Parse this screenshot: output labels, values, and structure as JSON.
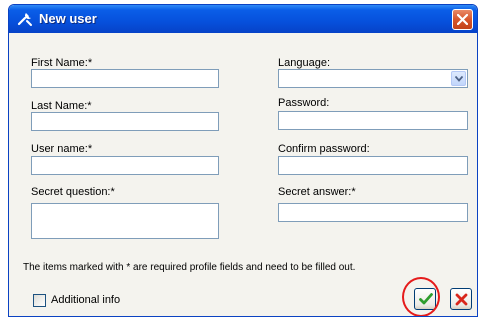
{
  "window": {
    "title": "New user"
  },
  "form": {
    "first_name_label": "First Name:*",
    "first_name_value": "",
    "last_name_label": "Last Name:*",
    "last_name_value": "",
    "user_name_label": "User name:*",
    "user_name_value": "",
    "secret_question_label": "Secret question:*",
    "secret_question_value": "",
    "language_label": "Language:",
    "language_value": "",
    "password_label": "Password:",
    "password_value": "",
    "confirm_password_label": "Confirm password:",
    "confirm_password_value": "",
    "secret_answer_label": "Secret answer:*",
    "secret_answer_value": ""
  },
  "footer": {
    "note": "The items marked with * are required profile fields and need to be filled out.",
    "additional_info_label": "Additional info",
    "additional_info_checked": false
  },
  "buttons": {
    "ok_icon": "green-check-icon",
    "cancel_icon": "red-x-icon"
  },
  "colors": {
    "titlebar": "#0650dc",
    "dialog_bg": "#f4f3ee",
    "field_border": "#7f9db9",
    "ok_green": "#2e9d2e",
    "cancel_red": "#d9261c",
    "highlight_ring": "#e51b1b"
  }
}
